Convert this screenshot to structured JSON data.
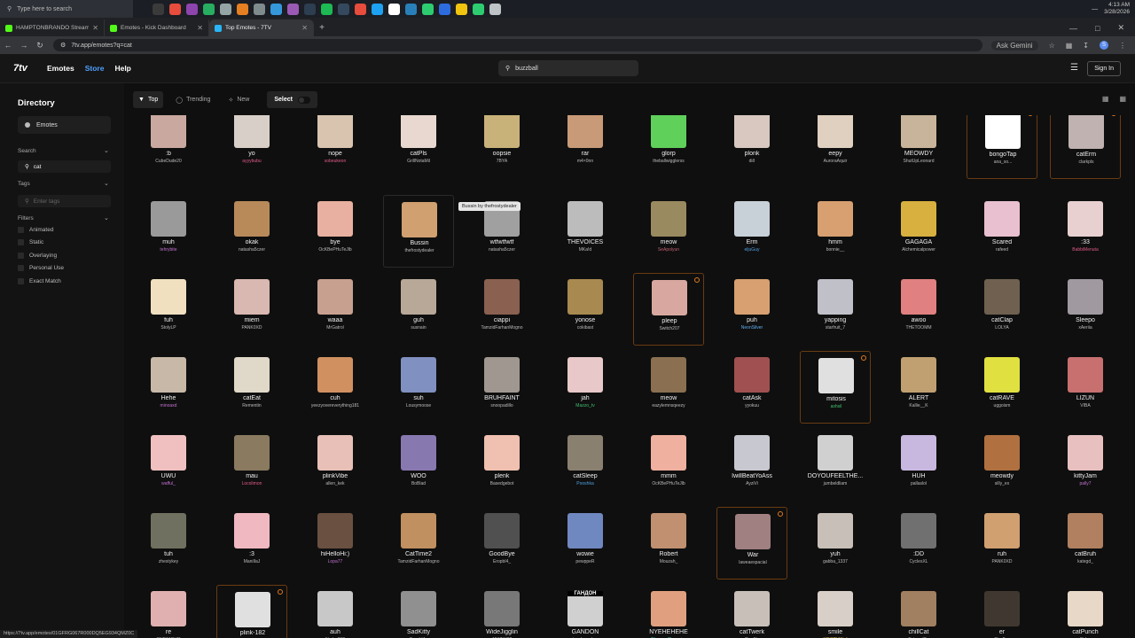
{
  "taskbar": {
    "search_placeholder": "Type here to search",
    "time": "4:13 AM",
    "date": "3/28/2026",
    "apps": [
      "#3a3a3a",
      "#e74c3c",
      "#8e44ad",
      "#27ae60",
      "#95a5a6",
      "#e67e22",
      "#7f8c8d",
      "#3498db",
      "#9b59b6",
      "#2c3e50",
      "#1db954",
      "#34495e",
      "#e74c3c",
      "#1da1f2",
      "#ffffff",
      "#2980b9",
      "#2ecc71",
      "#2d6cdf",
      "#f1c40f",
      "#2ecc71",
      "#bdc3c7"
    ]
  },
  "browser": {
    "tabs": [
      {
        "title": "HAMPTONBRANDO Stream - Ki",
        "active": false
      },
      {
        "title": "Emotes - Kick Dashboard",
        "active": false
      },
      {
        "title": "Top Emotes - 7TV",
        "active": true
      }
    ],
    "url": "7tv.app/emotes?q=cat",
    "gemini": "Ask Gemini",
    "status_url": "https://7tv.app/emotes/01GFRG067R000DQ5EG934QMZ0C"
  },
  "header": {
    "logo": "7tv",
    "nav": [
      "Emotes",
      "Store",
      "Help"
    ],
    "search_value": "buzzball",
    "signin": "Sign In"
  },
  "sidebar": {
    "title": "Directory",
    "emotes": "Emotes",
    "search_label": "Search",
    "search_value": "cat",
    "tags_label": "Tags",
    "tags_placeholder": "Enter tags",
    "filters_label": "Filters",
    "filters": [
      "Animated",
      "Static",
      "Overlaying",
      "Personal Use",
      "Exact Match"
    ]
  },
  "toolbar": {
    "top": "Top",
    "trending": "Trending",
    "new": "New",
    "select": "Select"
  },
  "tooltip": "Bussin by thefrostydealer",
  "emotes": [
    {
      "name": ":b",
      "author": "CubeDude20",
      "color": "#c9a8a0"
    },
    {
      "name": "yo",
      "author": "ayyybubu",
      "color": "#d8d0c8",
      "author_color": "#e05a8a"
    },
    {
      "name": "nope",
      "author": "sobeukeon",
      "color": "#d9c4b0",
      "author_color": "#e05a8a"
    },
    {
      "name": "catPls",
      "author": "GrillNotaMil",
      "color": "#e8d8d0"
    },
    {
      "name": "oopsie",
      "author": "7BYA",
      "color": "#c9b27a"
    },
    {
      "name": "rar",
      "author": "m4×0nn",
      "color": "#c99a78"
    },
    {
      "name": "glorp",
      "author": "theballwigglerss",
      "color": "#5fd05a"
    },
    {
      "name": "plonk",
      "author": "dið",
      "color": "#d8c8c0"
    },
    {
      "name": "eepy",
      "author": "AuroraAquir",
      "color": "#e0d0c0"
    },
    {
      "name": "MEOWDY",
      "author": "ShutUpLeonard",
      "color": "#c8b49a"
    },
    {
      "name": "bongoTap",
      "author": "ana_so...",
      "color": "#ffffff",
      "highlight": true
    },
    {
      "name": "catErm",
      "author": "clarkpls",
      "color": "#bfb2b0",
      "highlight": true
    },
    {
      "name": "muh",
      "author": "tehrybite",
      "color": "#9a9a9a",
      "author_color": "#c070d0"
    },
    {
      "name": "okak",
      "author": "natasha5czer",
      "color": "#b88a5a"
    },
    {
      "name": "bye",
      "author": "OcKBePHuTeJlb",
      "color": "#e8b0a0"
    },
    {
      "name": "Bussin",
      "author": "thefrostydealer",
      "color": "#d0a070",
      "hover": true
    },
    {
      "name": "wtfwtfwtf",
      "author": "natasha5czer",
      "color": "#a0a0a0"
    },
    {
      "name": "THEVOICES",
      "author": "MKa!d",
      "color": "#bcbcbc"
    },
    {
      "name": "meow",
      "author": "SeApolyun",
      "color": "#9a8a60",
      "author_color": "#c06070"
    },
    {
      "name": "Erm",
      "author": "eljuGuy",
      "color": "#c8d0d8",
      "author_color": "#50a0e0"
    },
    {
      "name": "hmm",
      "author": "bonnie__",
      "color": "#d8a070"
    },
    {
      "name": "GAGAGA",
      "author": "Alchemicalpower",
      "color": "#d8b040"
    },
    {
      "name": "Scared",
      "author": "rafeed",
      "color": "#e8c0d0"
    },
    {
      "name": ":33",
      "author": "BabbiMenuta",
      "color": "#e8d0d0",
      "author_color": "#e05a8a"
    },
    {
      "name": "fuh",
      "author": "StolyLP",
      "color": "#f0e0c0"
    },
    {
      "name": "miem",
      "author": "PANK0XD",
      "color": "#d8b8b0"
    },
    {
      "name": "waaa",
      "author": "MrGatrol",
      "color": "#c8a090"
    },
    {
      "name": "guh",
      "author": "susnain",
      "color": "#b8a898"
    },
    {
      "name": "ciappi",
      "author": "TamzidFarhanMogno",
      "color": "#8a6050"
    },
    {
      "name": "yonose",
      "author": "cokibast",
      "color": "#a88a50"
    },
    {
      "name": "pleep",
      "author": "Switch207",
      "color": "#d8a8a0",
      "highlight": true
    },
    {
      "name": "puh",
      "author": "NeonSilver",
      "color": "#d8a070",
      "author_color": "#60b0f0"
    },
    {
      "name": "yapping",
      "author": "starfruit_7",
      "color": "#c0c0c8"
    },
    {
      "name": "awoo",
      "author": "THETOOMM",
      "color": "#e08080"
    },
    {
      "name": "catClap",
      "author": "LOLYA",
      "color": "#706050"
    },
    {
      "name": "Sleepo",
      "author": "xAeriia",
      "color": "#a09aa0"
    },
    {
      "name": "Hehe",
      "author": "minoaxd",
      "color": "#c8b8a8",
      "author_color": "#c070d0"
    },
    {
      "name": "catEat",
      "author": "Rementin",
      "color": "#e0d8c8"
    },
    {
      "name": "cuh",
      "author": "yeezyovereverything181",
      "color": "#d09060"
    },
    {
      "name": "suh",
      "author": "Lousymoose",
      "color": "#8090c0"
    },
    {
      "name": "BRUHFAINT",
      "author": "snoopadillo",
      "color": "#a09890"
    },
    {
      "name": "jah",
      "author": "Mazzo_tv",
      "color": "#e8c8c8",
      "author_color": "#40c070"
    },
    {
      "name": "meow",
      "author": "eazylemnsqeezy",
      "color": "#8a7050"
    },
    {
      "name": "catAsk",
      "author": "yyokuu",
      "color": "#a05050"
    },
    {
      "name": "mitosis",
      "author": "ashsil",
      "color": "#e0e0e0",
      "highlight": true,
      "author_color": "#40c070"
    },
    {
      "name": "ALERT",
      "author": "Kallie__K",
      "color": "#c0a070"
    },
    {
      "name": "catRAVE",
      "author": "uggoism",
      "color": "#e0e040"
    },
    {
      "name": "LIZUN",
      "author": "VIBA",
      "color": "#c87070"
    },
    {
      "name": "UWU",
      "author": "wafful_",
      "color": "#f0c0c0",
      "author_color": "#c070d0"
    },
    {
      "name": "mau",
      "author": "Locolimon",
      "color": "#8a7a60",
      "author_color": "#e05a8a"
    },
    {
      "name": "plinkVibe",
      "author": "allen_kek",
      "color": "#e8c0b8"
    },
    {
      "name": "WOO",
      "author": "BoBlad",
      "color": "#8878b0"
    },
    {
      "name": "plenk",
      "author": "Basedgebot",
      "color": "#f0c0b0"
    },
    {
      "name": "catSleep",
      "author": "Pooshka",
      "color": "#8a8070",
      "author_color": "#50a0e0"
    },
    {
      "name": "mmm",
      "author": "OcKBePHuTeJlb",
      "color": "#f0b0a0"
    },
    {
      "name": "IwillBeatYoAss",
      "author": "AyziVi",
      "color": "#c8c8d0"
    },
    {
      "name": "DOYOUFEELTHE...",
      "author": "jumbeldliam",
      "color": "#d0d0d0"
    },
    {
      "name": "HUH",
      "author": "pallaslol",
      "color": "#c8b8e0"
    },
    {
      "name": "meowdy",
      "author": "silly_ex",
      "color": "#b07040"
    },
    {
      "name": "kittyJam",
      "author": "pally7",
      "color": "#e8c0c0",
      "author_color": "#c070d0"
    },
    {
      "name": "tuh",
      "author": "zhestykey",
      "color": "#707060"
    },
    {
      "name": ":3",
      "author": "ManiIlaJ",
      "color": "#f0b8c0"
    },
    {
      "name": "hiHelloHi:)",
      "author": "Lopa77",
      "color": "#6a5040",
      "author_color": "#c070d0"
    },
    {
      "name": "CatTime2",
      "author": "TamzidFarhanMogno",
      "color": "#c09060"
    },
    {
      "name": "GoodBye",
      "author": "Eropbl4_",
      "color": "#505050"
    },
    {
      "name": "wowie",
      "author": "pewppeR",
      "color": "#7088c0"
    },
    {
      "name": "Robert",
      "author": "Mouzah_",
      "color": "#c09070"
    },
    {
      "name": "War",
      "author": "laweaespacial",
      "color": "#a08080",
      "highlight": true
    },
    {
      "name": "yuh",
      "author": "gabba_1337",
      "color": "#c8c0b8"
    },
    {
      "name": ":DD",
      "author": "CyclesXL",
      "color": "#707070"
    },
    {
      "name": "ruh",
      "author": "PANK0XD",
      "color": "#d0a070"
    },
    {
      "name": "catBruh",
      "author": "kategd_",
      "color": "#b08060"
    },
    {
      "name": "re",
      "author": "ONE84OUR",
      "color": "#e0b0b0"
    },
    {
      "name": "plink-182",
      "author": "vicneel",
      "color": "#e0e0e0",
      "highlight": true
    },
    {
      "name": "auh",
      "author": "Nydra007",
      "color": "#c8c8c8"
    },
    {
      "name": "SadKitty",
      "author": "Eropbl4_",
      "color": "#909090"
    },
    {
      "name": "WideJigglin",
      "author": "JAWNY02",
      "color": "#787878"
    },
    {
      "name": "GANDON",
      "author": "tg_shewakxz",
      "color": "#d0d0d0",
      "caption": "ГАНДОН"
    },
    {
      "name": "NYEHEHEHE",
      "author": "ObscureCharming",
      "color": "#e0a080",
      "author_color": "#40c0b0"
    },
    {
      "name": "catTwerk",
      "author": "RanStr",
      "color": "#c8c0b8"
    },
    {
      "name": "smile",
      "author": "KRISTIAN_I",
      "color": "#d8d0c8",
      "author_color": "#e0c040"
    },
    {
      "name": "chillCat",
      "author": "ExtramiRe",
      "color": "#a08060"
    },
    {
      "name": "er",
      "author": "Giraffge",
      "color": "#403830"
    },
    {
      "name": "catPunch",
      "author": "St.ly_",
      "color": "#e8d8c8"
    }
  ]
}
